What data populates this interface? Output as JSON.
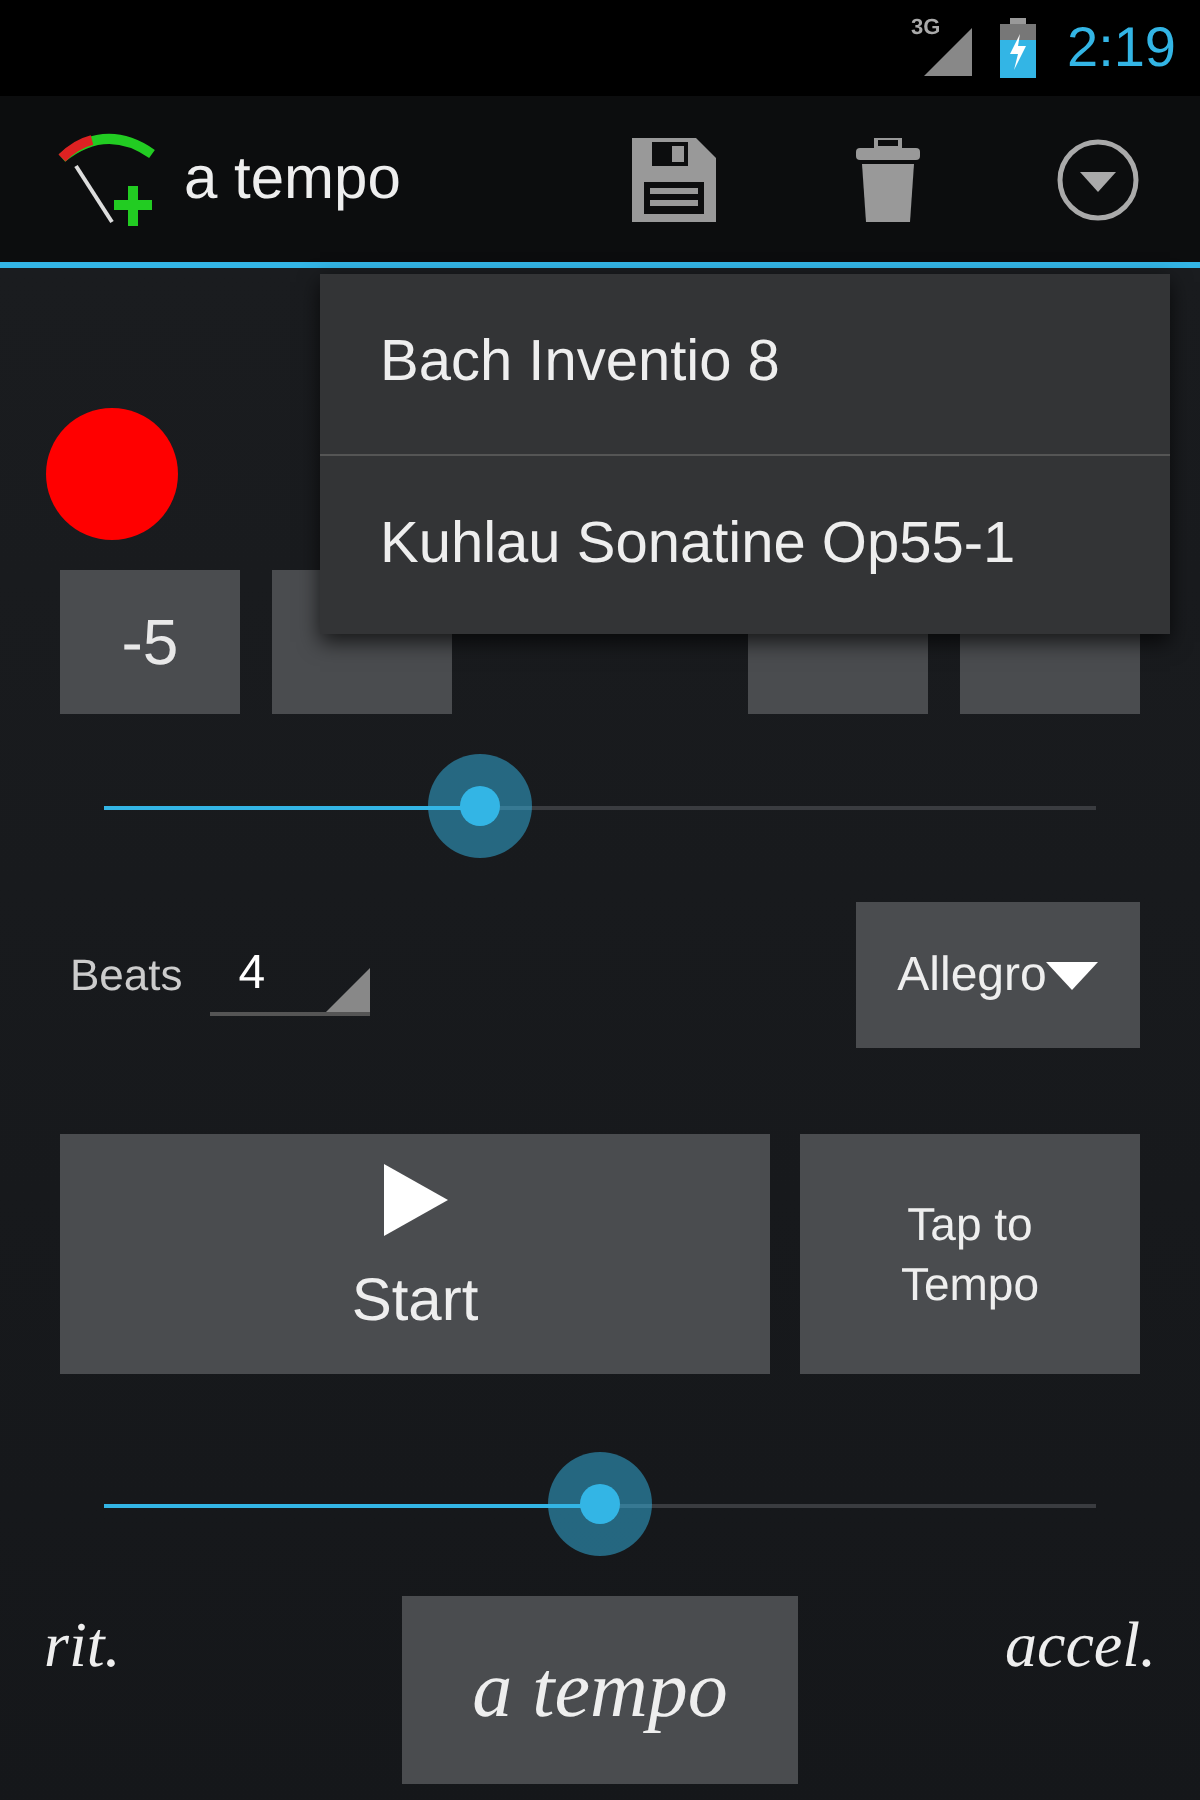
{
  "status_bar": {
    "network": "3G",
    "time": "2:19"
  },
  "action_bar": {
    "title": "a tempo"
  },
  "menu": {
    "items": [
      {
        "label": "Bach Inventio 8"
      },
      {
        "label": "Kuhlau Sonatine Op55-1"
      }
    ]
  },
  "beat_light": {
    "on": true
  },
  "tempo": {
    "buttons_left": [
      {
        "label": "-5"
      }
    ]
  },
  "tempo_slider": {
    "level": 0.38
  },
  "beats": {
    "label": "Beats",
    "value": "4"
  },
  "tempo_name": {
    "value": "Allegro"
  },
  "start_button": {
    "label": "Start"
  },
  "tap_button": {
    "label": "Tap to Tempo"
  },
  "rate_slider": {
    "level": 0.5
  },
  "rit_label": "rit.",
  "a_tempo_button": "a tempo",
  "accel_label": "accel."
}
